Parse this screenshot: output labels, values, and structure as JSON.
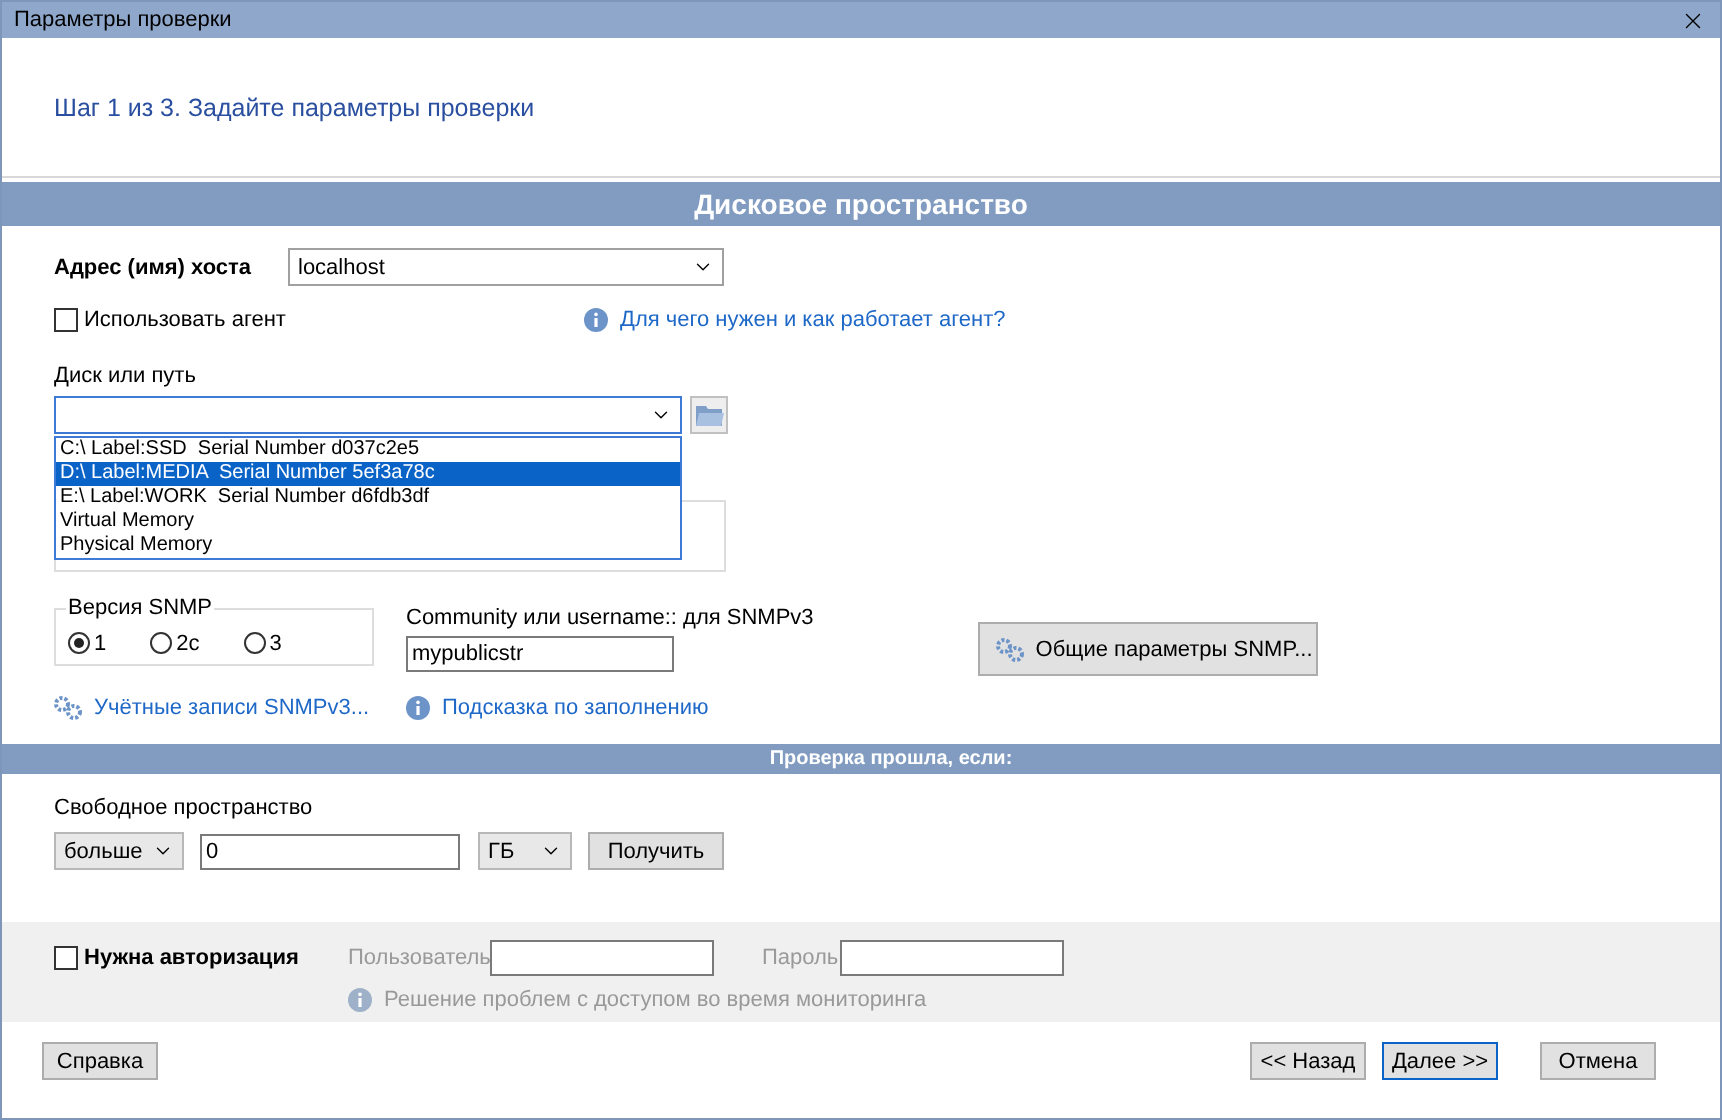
{
  "window": {
    "title": "Параметры проверки"
  },
  "step": "Шаг 1 из 3. Задайте параметры проверки",
  "section_title": "Дисковое пространство",
  "host": {
    "label": "Адрес (имя) хоста",
    "value": "localhost"
  },
  "agent": {
    "label": "Использовать агент",
    "checked": false,
    "help_link": "Для чего нужен и как работает агент?"
  },
  "disk": {
    "label": "Диск или путь",
    "expanded": true,
    "options": [
      {
        "text": "C:\\ Label:SSD  Serial Number d037c2e5",
        "selected": false
      },
      {
        "text": "D:\\ Label:MEDIA  Serial Number 5ef3a78c",
        "selected": true
      },
      {
        "text": "E:\\ Label:WORK  Serial Number d6fdb3df",
        "selected": false
      },
      {
        "text": "Virtual Memory",
        "selected": false
      },
      {
        "text": "Physical Memory",
        "selected": false
      }
    ]
  },
  "snmp": {
    "group_label": "Версия SNMP",
    "versions": [
      {
        "label": "1",
        "selected": true
      },
      {
        "label": "2c",
        "selected": false
      },
      {
        "label": "3",
        "selected": false
      }
    ],
    "community_label": "Community или username:: для SNMPv3",
    "community_value": "mypublicstr",
    "accounts_link": "Учётные записи SNMPv3...",
    "hint_link": "Подсказка по заполнению",
    "settings_button": "Общие параметры SNMP..."
  },
  "condition": {
    "title": "Проверка прошла, если:",
    "label": "Свободное пространство",
    "operator": "больше",
    "value": "0",
    "unit": "ГБ",
    "fetch_button": "Получить"
  },
  "auth": {
    "label": "Нужна авторизация",
    "checked": false,
    "user_label": "Пользователь",
    "password_label": "Пароль",
    "help_link": "Решение проблем с доступом во время мониторинга"
  },
  "buttons": [
    {
      "label": "Справка",
      "default": false
    },
    {
      "label": "<< Назад",
      "default": false
    },
    {
      "label": "Далее >>",
      "default": true
    },
    {
      "label": "Отмена",
      "default": false
    }
  ]
}
